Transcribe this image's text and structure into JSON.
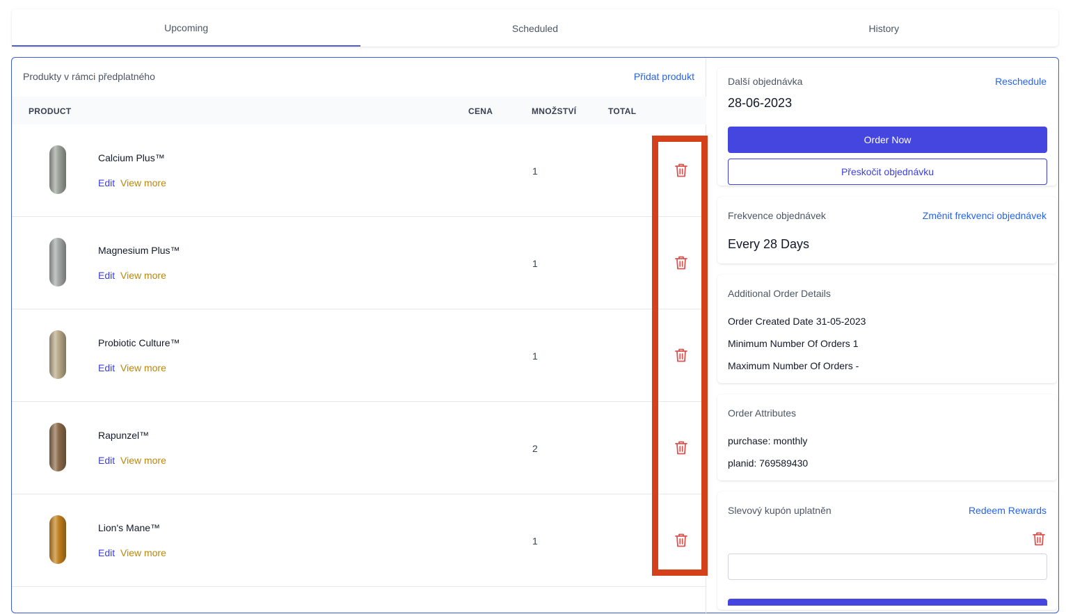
{
  "tabs": [
    {
      "label": "Upcoming",
      "active": true
    },
    {
      "label": "Scheduled",
      "active": false
    },
    {
      "label": "History",
      "active": false
    }
  ],
  "products_panel": {
    "title": "Produkty v rámci předplatného",
    "add_link": "Přidat produkt",
    "columns": {
      "product": "PRODUCT",
      "price": "CENA",
      "quantity": "MNOŽSTVÍ",
      "total": "TOTAL"
    },
    "edit_label": "Edit",
    "view_more_label": "View more",
    "items": [
      {
        "name": "Calcium Plus™",
        "quantity": "1",
        "capsule_color": "#9ca39a"
      },
      {
        "name": "Magnesium Plus™",
        "quantity": "1",
        "capsule_color": "#a3a8a6"
      },
      {
        "name": "Probiotic Culture™",
        "quantity": "1",
        "capsule_color": "#b8a988"
      },
      {
        "name": "Rapunzel™",
        "quantity": "2",
        "capsule_color": "#8a6a4a"
      },
      {
        "name": "Lion's Mane™",
        "quantity": "1",
        "capsule_color": "#c2811e"
      }
    ]
  },
  "next_order": {
    "title": "Další objednávka",
    "reschedule": "Reschedule",
    "date": "28-06-2023",
    "order_now": "Order Now",
    "skip": "Přeskočit objednávku"
  },
  "frequency": {
    "title": "Frekvence objednávek",
    "change_link": "Změnit frekvenci objednávek",
    "value": "Every 28 Days"
  },
  "additional_details": {
    "title": "Additional Order Details",
    "lines": [
      "Order Created Date 31-05-2023",
      "Minimum Number Of Orders 1",
      "Maximum Number Of Orders -"
    ]
  },
  "attributes": {
    "title": "Order Attributes",
    "lines": [
      "purchase: monthly",
      "planid: 769589430"
    ]
  },
  "coupon": {
    "title": "Slevový kupón uplatněn",
    "redeem_link": "Redeem Rewards",
    "input_value": ""
  },
  "colors": {
    "accent": "#4546e0",
    "link": "#2563eb",
    "trash": "#d9534f",
    "highlight": "#d4401a"
  }
}
